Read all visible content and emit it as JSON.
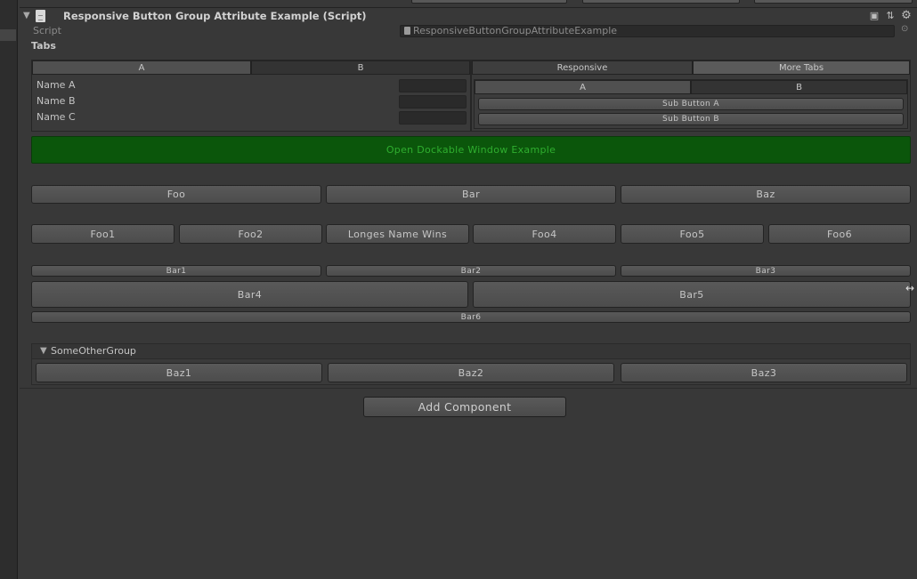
{
  "component": {
    "title": "Responsive Button Group Attribute Example (Script)",
    "script_label": "Script",
    "script_value": "ResponsiveButtonGroupAttributeExample"
  },
  "tabs_section": {
    "label": "Tabs",
    "left_tabs": [
      "A",
      "B"
    ],
    "fields": [
      {
        "label": "Name A",
        "value": ""
      },
      {
        "label": "Name B",
        "value": ""
      },
      {
        "label": "Name C",
        "value": ""
      }
    ],
    "right_tabs": [
      "Responsive",
      "More Tabs"
    ],
    "sub_tabs": [
      "A",
      "B"
    ],
    "sub_buttons": [
      "Sub Button A",
      "Sub Button B"
    ]
  },
  "open_window_button": "Open Dockable Window Example",
  "row1": [
    "Foo",
    "Bar",
    "Baz"
  ],
  "row2": [
    "Foo1",
    "Foo2",
    "Longes Name Wins",
    "Foo4",
    "Foo5",
    "Foo6"
  ],
  "row3": [
    "Bar1",
    "Bar2",
    "Bar3"
  ],
  "row4": [
    "Bar4",
    "Bar5"
  ],
  "row5": [
    "Bar6"
  ],
  "other_group": {
    "title": "SomeOtherGroup",
    "buttons": [
      "Baz1",
      "Baz2",
      "Baz3"
    ]
  },
  "add_component": "Add Component",
  "colors": {
    "background": "#383838",
    "green_button": "#0b560b",
    "green_text": "#2fae2f"
  },
  "icons": [
    "fold-arrow-icon",
    "script-file-icon",
    "book-icon",
    "presets-icon",
    "gear-icon",
    "object-picker-icon",
    "resize-cursor-icon"
  ]
}
